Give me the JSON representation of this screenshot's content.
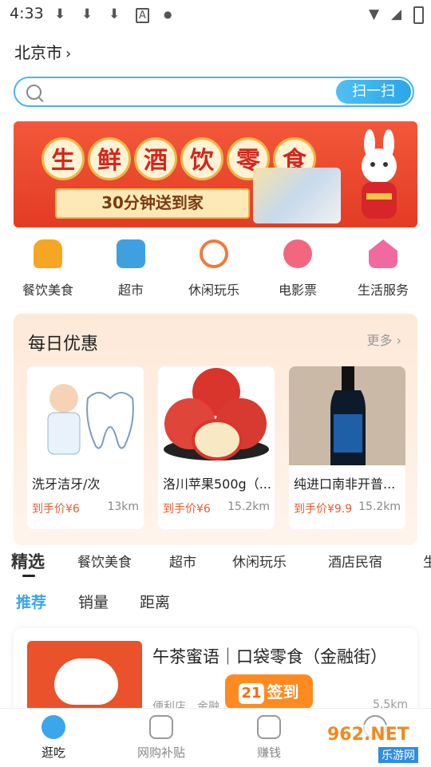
{
  "status_bar": {
    "time": "4:33"
  },
  "location": {
    "city": "北京市"
  },
  "search": {
    "placeholder": "",
    "scan_label": "扫一扫"
  },
  "banner": {
    "title_chars": [
      "生",
      "鲜",
      "酒",
      "饮",
      "零",
      "食"
    ],
    "subtitle": "30分钟送到家"
  },
  "categories": [
    {
      "label": "餐饮美食",
      "icon": "burger-icon",
      "color": "#f6a623"
    },
    {
      "label": "超市",
      "icon": "store-icon",
      "color": "#3fa0e0"
    },
    {
      "label": "休闲玩乐",
      "icon": "ferris-wheel-icon",
      "color": "#f07a3a"
    },
    {
      "label": "电影票",
      "icon": "film-reel-icon",
      "color": "#f2667f"
    },
    {
      "label": "生活服务",
      "icon": "home-heart-icon",
      "color": "#f06aa0"
    }
  ],
  "daily_deals": {
    "title": "每日优惠",
    "more": "更多",
    "items": [
      {
        "name": "洗牙洁牙/次",
        "price": "到手价¥6",
        "distance": "13km"
      },
      {
        "name": "洛川苹果500g（...",
        "price": "到手价¥6",
        "distance": "15.2km"
      },
      {
        "name": "纯进口南非开普...",
        "price": "到手价¥9.9",
        "distance": "15.2km"
      }
    ]
  },
  "tabs": [
    "精选",
    "餐饮美食",
    "超市",
    "休闲玩乐",
    "酒店民宿",
    "生"
  ],
  "subtabs": [
    "推荐",
    "销量",
    "距离"
  ],
  "shop": {
    "name": "午茶蜜语｜口袋零食（金融街）",
    "meta": "便利店　金融...　　中一层",
    "distance": "5.5km"
  },
  "signin": {
    "day": "21",
    "label": "签到"
  },
  "bottom_nav": [
    {
      "label": "逛吃",
      "icon": "blob-icon"
    },
    {
      "label": "网购补贴",
      "icon": "bag-icon"
    },
    {
      "label": "赚钱",
      "icon": "wallet-icon"
    },
    {
      "label": "",
      "icon": "chat-icon"
    }
  ],
  "watermark": {
    "top": "962.NET",
    "bottom": "乐游网"
  }
}
